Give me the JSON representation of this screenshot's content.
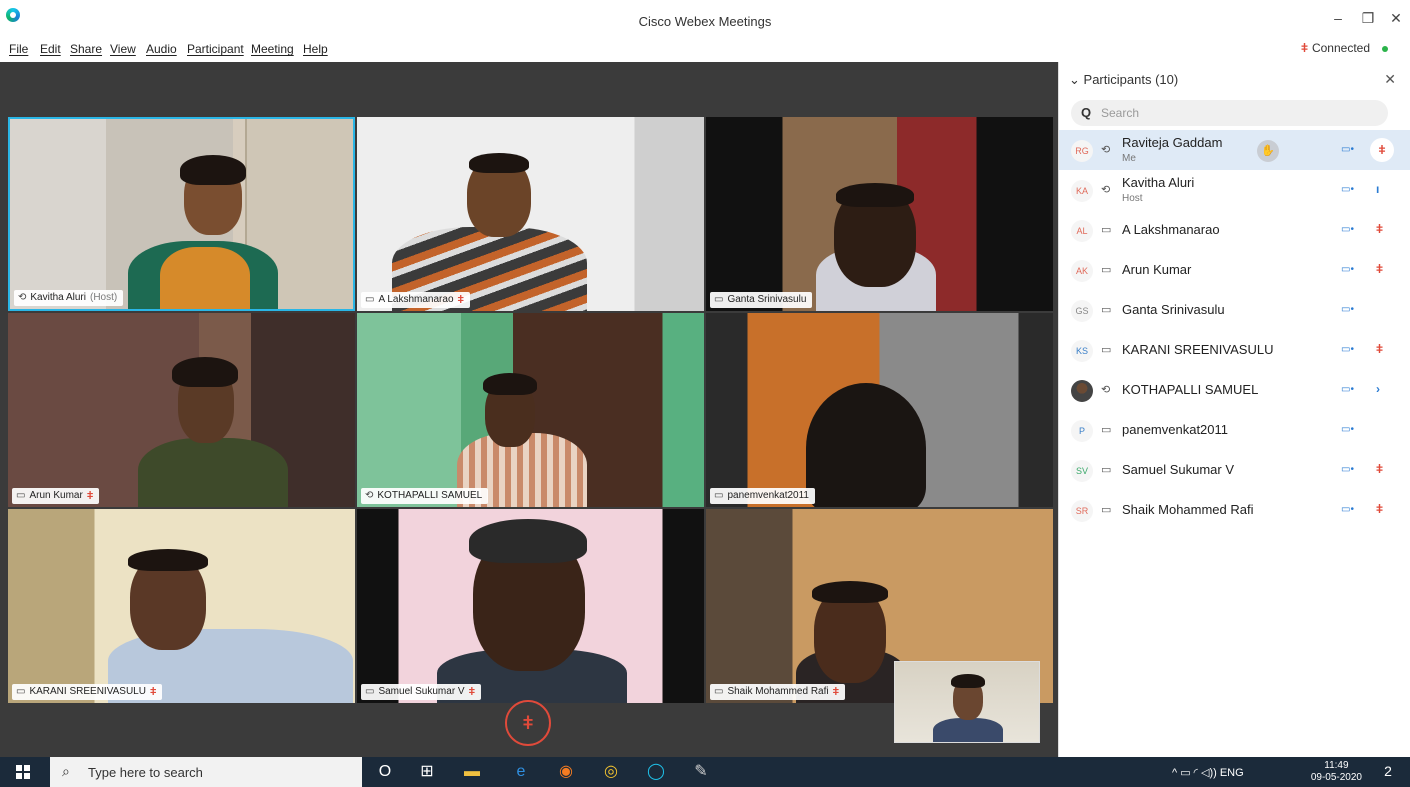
{
  "window": {
    "title": "Cisco Webex Meetings",
    "minimize": "–",
    "restore": "❐",
    "close": "✕",
    "connection_mic": "ǂ",
    "connection": "Connected"
  },
  "menu": [
    "File",
    "Edit",
    "Share",
    "View",
    "Audio",
    "Participant",
    "Meeting",
    "Help"
  ],
  "tiles": [
    {
      "name": "Kavitha Aluri",
      "suffix": "(Host)",
      "icon": "⟲",
      "muted": false
    },
    {
      "name": "A Lakshmanarao",
      "suffix": "",
      "icon": "▭",
      "muted": true
    },
    {
      "name": "Ganta Srinivasulu",
      "suffix": "",
      "icon": "▭",
      "muted": false
    },
    {
      "name": "Arun Kumar",
      "suffix": "",
      "icon": "▭",
      "muted": true
    },
    {
      "name": "KOTHAPALLI SAMUEL",
      "suffix": "",
      "icon": "⟲",
      "muted": false
    },
    {
      "name": "panemvenkat2011",
      "suffix": "",
      "icon": "▭",
      "muted": false
    },
    {
      "name": "KARANI SREENIVASULU",
      "suffix": "",
      "icon": "▭",
      "muted": true
    },
    {
      "name": "Samuel Sukumar V",
      "suffix": "",
      "icon": "▭",
      "muted": true
    },
    {
      "name": "Shaik Mohammed Rafi",
      "suffix": "",
      "icon": "▭",
      "muted": true
    }
  ],
  "mute_glyph": "ǂ",
  "panel": {
    "header": "Participants (10)",
    "chevron": "⌄",
    "close": "✕",
    "search_icon": "Q",
    "search_placeholder": "Search",
    "participants": [
      {
        "initials": "RG",
        "name": "Raviteja Gaddam",
        "role": "Me",
        "device": "⟲",
        "video": "▭•",
        "mic": "ǂ",
        "mic_state": "muted",
        "hand": "✋"
      },
      {
        "initials": "KA",
        "name": "Kavitha Aluri",
        "role": "Host",
        "device": "⟲",
        "video": "▭•",
        "mic": "ı",
        "mic_state": "on"
      },
      {
        "initials": "AL",
        "name": "A Lakshmanarao",
        "role": "",
        "device": "▭",
        "video": "▭•",
        "mic": "ǂ",
        "mic_state": "muted"
      },
      {
        "initials": "AK",
        "name": "Arun Kumar",
        "role": "",
        "device": "▭",
        "video": "▭•",
        "mic": "ǂ",
        "mic_state": "muted"
      },
      {
        "initials": "GS",
        "name": "Ganta Srinivasulu",
        "role": "",
        "device": "▭",
        "video": "▭•",
        "mic": "",
        "mic_state": "none"
      },
      {
        "initials": "KS",
        "name": "KARANI SREENIVASULU",
        "role": "",
        "device": "▭",
        "video": "▭•",
        "mic": "ǂ",
        "mic_state": "muted"
      },
      {
        "initials": "",
        "name": "KOTHAPALLI SAMUEL",
        "role": "",
        "device": "⟲",
        "video": "▭•",
        "mic": "›",
        "mic_state": "on",
        "photo": true
      },
      {
        "initials": "P",
        "name": "panemvenkat2011",
        "role": "",
        "device": "▭",
        "video": "▭•",
        "mic": "",
        "mic_state": "none"
      },
      {
        "initials": "SV",
        "name": "Samuel Sukumar V",
        "role": "",
        "device": "▭",
        "video": "▭•",
        "mic": "ǂ",
        "mic_state": "muted"
      },
      {
        "initials": "SR",
        "name": "Shaik Mohammed Rafi",
        "role": "",
        "device": "▭",
        "video": "▭•",
        "mic": "ǂ",
        "mic_state": "muted"
      }
    ]
  },
  "taskbar": {
    "search_text": "Type here to search",
    "search_icon": "⌕",
    "icons": [
      "O",
      "⊞",
      "▬",
      "e",
      "◉",
      "◎",
      "◯",
      "✎"
    ],
    "tray": "^  ▭  ◜  ◁))  ENG",
    "time": "11:49",
    "date": "09-05-2020",
    "notify": "2"
  }
}
